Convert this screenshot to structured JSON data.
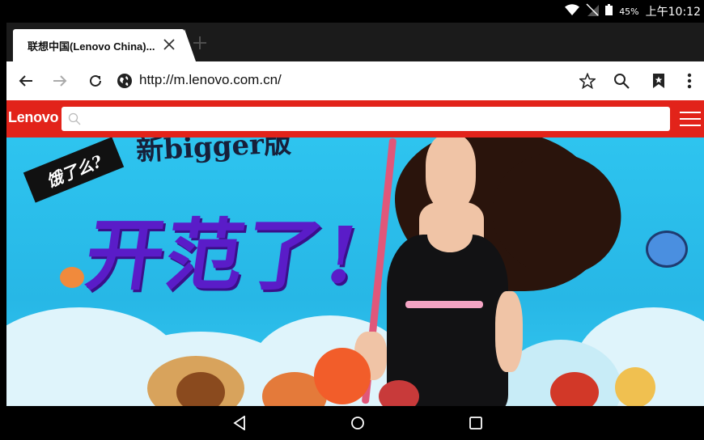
{
  "status_bar": {
    "battery_pct": "45%",
    "time": "上午10:12",
    "icons": [
      "wifi-icon",
      "no-sim-icon",
      "battery-icon"
    ]
  },
  "tab": {
    "title": "联想中国(Lenovo China)..."
  },
  "toolbar": {
    "url": "http://m.lenovo.com.cn/"
  },
  "site": {
    "logo": "Lenovo",
    "brand_color": "#e2231a"
  },
  "banner": {
    "headline": "开范了!",
    "sticker": "饿了么?",
    "top_text": "新bigger版"
  }
}
